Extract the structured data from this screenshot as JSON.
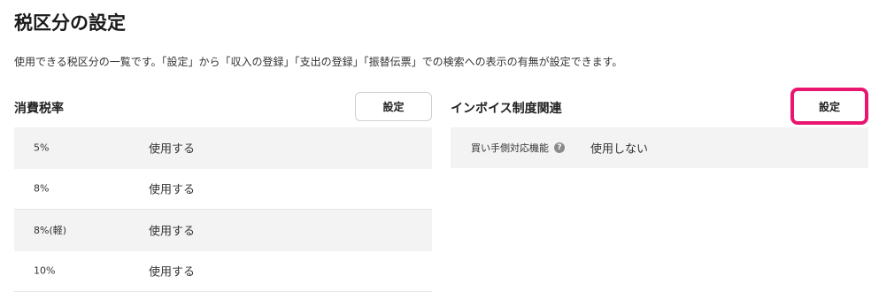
{
  "page": {
    "title": "税区分の設定",
    "description": "使用できる税区分の一覧です。「設定」から「収入の登録」「支出の登録」「振替伝票」での検索への表示の有無が設定できます。"
  },
  "consumption_tax": {
    "heading": "消費税率",
    "settings_label": "設定",
    "rows": [
      {
        "rate": "5%",
        "status": "使用する"
      },
      {
        "rate": "8%",
        "status": "使用する"
      },
      {
        "rate": "8%(軽)",
        "status": "使用する"
      },
      {
        "rate": "10%",
        "status": "使用する"
      }
    ]
  },
  "invoice": {
    "heading": "インボイス制度関連",
    "settings_label": "設定",
    "highlight_color": "#e8166e",
    "rows": [
      {
        "label": "買い手側対応機能",
        "help_icon": "question-circle-icon",
        "status": "使用しない"
      }
    ]
  }
}
